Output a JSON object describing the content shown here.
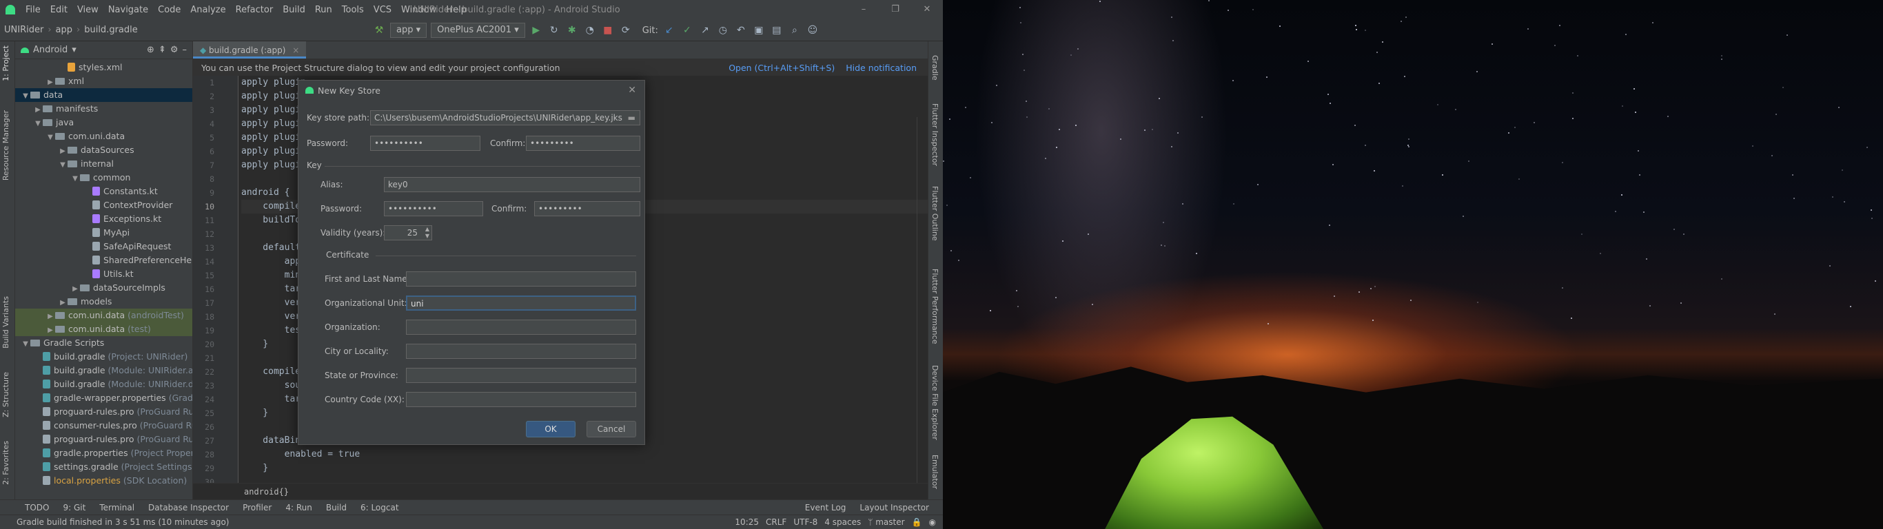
{
  "menubar": {
    "items": [
      "File",
      "Edit",
      "View",
      "Navigate",
      "Code",
      "Analyze",
      "Refactor",
      "Build",
      "Run",
      "Tools",
      "VCS",
      "Window",
      "Help"
    ],
    "window_title": "UNIRider - build.gradle (:app) - Android Studio"
  },
  "navbar": {
    "crumbs": [
      "UNIRider",
      "app",
      "build.gradle"
    ],
    "config": "app",
    "device": "OnePlus AC2001",
    "git_label": "Git:"
  },
  "left_strip": {
    "project": "1: Project",
    "resource": "Resource Manager",
    "build_variants": "Build Variants",
    "structure": "Z: Structure",
    "favorites": "2: Favorites"
  },
  "right_strip": {
    "gradle": "Gradle",
    "flutter_inspector": "Flutter Inspector",
    "flutter_outline": "Flutter Outline",
    "flutter_performance": "Flutter Performance",
    "device_file_explorer": "Device File Explorer",
    "emulator": "Emulator"
  },
  "project": {
    "view": "Android",
    "tree": [
      {
        "label": "styles.xml",
        "indent": 4,
        "kind": "file"
      },
      {
        "label": "xml",
        "indent": 3,
        "kind": "folder",
        "arrow": "▶"
      },
      {
        "label": "data",
        "indent": 1,
        "kind": "folder",
        "arrow": "▼",
        "selected": true
      },
      {
        "label": "manifests",
        "indent": 2,
        "kind": "folder",
        "arrow": "▶"
      },
      {
        "label": "java",
        "indent": 2,
        "kind": "folder",
        "arrow": "▼"
      },
      {
        "label": "com.uni.data",
        "indent": 3,
        "kind": "folder",
        "arrow": "▼"
      },
      {
        "label": "dataSources",
        "indent": 4,
        "kind": "folder",
        "arrow": "▶"
      },
      {
        "label": "internal",
        "indent": 4,
        "kind": "folder",
        "arrow": "▼"
      },
      {
        "label": "common",
        "indent": 5,
        "kind": "folder",
        "arrow": "▼"
      },
      {
        "label": "Constants.kt",
        "indent": 6,
        "kind": "file"
      },
      {
        "label": "ContextProvider",
        "indent": 6,
        "kind": "file"
      },
      {
        "label": "Exceptions.kt",
        "indent": 6,
        "kind": "file"
      },
      {
        "label": "MyApi",
        "indent": 6,
        "kind": "file"
      },
      {
        "label": "SafeApiRequest",
        "indent": 6,
        "kind": "file"
      },
      {
        "label": "SharedPreferenceHelper",
        "indent": 6,
        "kind": "file"
      },
      {
        "label": "Utils.kt",
        "indent": 6,
        "kind": "file"
      },
      {
        "label": "dataSourceImpls",
        "indent": 5,
        "kind": "folder",
        "arrow": "▶"
      },
      {
        "label": "models",
        "indent": 4,
        "kind": "folder",
        "arrow": "▶"
      },
      {
        "label": "com.uni.data",
        "suffix": "(androidTest)",
        "indent": 3,
        "kind": "folder",
        "arrow": "▶",
        "hl": true
      },
      {
        "label": "com.uni.data",
        "suffix": "(test)",
        "indent": 3,
        "kind": "folder",
        "arrow": "▶",
        "hl": true
      },
      {
        "label": "Gradle Scripts",
        "indent": 1,
        "kind": "folder",
        "arrow": "▼"
      },
      {
        "label": "build.gradle",
        "suffix": "(Project: UNIRider)",
        "indent": 2,
        "kind": "file"
      },
      {
        "label": "build.gradle",
        "suffix": "(Module: UNIRider.app)",
        "indent": 2,
        "kind": "file"
      },
      {
        "label": "build.gradle",
        "suffix": "(Module: UNIRider.data)",
        "indent": 2,
        "kind": "file"
      },
      {
        "label": "gradle-wrapper.properties",
        "suffix": "(Gradle Ver",
        "indent": 2,
        "kind": "file"
      },
      {
        "label": "proguard-rules.pro",
        "suffix": "(ProGuard Rules fo",
        "indent": 2,
        "kind": "file"
      },
      {
        "label": "consumer-rules.pro",
        "suffix": "(ProGuard Rules fo",
        "indent": 2,
        "kind": "file"
      },
      {
        "label": "proguard-rules.pro",
        "suffix": "(ProGuard Rules fo",
        "indent": 2,
        "kind": "file"
      },
      {
        "label": "gradle.properties",
        "suffix": "(Project Properties)",
        "indent": 2,
        "kind": "file"
      },
      {
        "label": "settings.gradle",
        "suffix": "(Project Settings)",
        "indent": 2,
        "kind": "file"
      },
      {
        "label": "local.properties",
        "suffix": "(SDK Location)",
        "indent": 2,
        "kind": "file",
        "warn": true
      }
    ]
  },
  "editor": {
    "tab": "build.gradle (:app)",
    "notification": "You can use the Project Structure dialog to view and edit your project configuration",
    "open_link": "Open (Ctrl+Alt+Shift+S)",
    "hide_link": "Hide notification",
    "breadcrumb": "android{}",
    "lines": [
      {
        "n": "1",
        "t": "apply plugin"
      },
      {
        "n": "2",
        "t": "apply plugin"
      },
      {
        "n": "3",
        "t": "apply plugin"
      },
      {
        "n": "4",
        "t": "apply plugin"
      },
      {
        "n": "5",
        "t": "apply plugin"
      },
      {
        "n": "6",
        "t": "apply plugin"
      },
      {
        "n": "7",
        "t": "apply plugin"
      },
      {
        "n": "8",
        "t": ""
      },
      {
        "n": "9",
        "t": "android {"
      },
      {
        "n": "10",
        "t": "    compileS",
        "cur": true
      },
      {
        "n": "11",
        "t": "    buildToo"
      },
      {
        "n": "12",
        "t": ""
      },
      {
        "n": "13",
        "t": "    defaultC"
      },
      {
        "n": "14",
        "t": "        appl"
      },
      {
        "n": "15",
        "t": "        minS"
      },
      {
        "n": "16",
        "t": "        targ"
      },
      {
        "n": "17",
        "t": "        vers"
      },
      {
        "n": "18",
        "t": "        vers"
      },
      {
        "n": "19",
        "t": "        test"
      },
      {
        "n": "20",
        "t": "    }"
      },
      {
        "n": "21",
        "t": ""
      },
      {
        "n": "22",
        "t": "    compileO"
      },
      {
        "n": "23",
        "t": "        sour"
      },
      {
        "n": "24",
        "t": "        targ"
      },
      {
        "n": "25",
        "t": "    }"
      },
      {
        "n": "26",
        "t": ""
      },
      {
        "n": "27",
        "t": "    dataBind"
      },
      {
        "n": "28",
        "t": "        enabled = true"
      },
      {
        "n": "29",
        "t": "    }"
      },
      {
        "n": "30",
        "t": ""
      }
    ]
  },
  "dialog": {
    "title": "New Key Store",
    "keystore_label": "Key store path:",
    "keystore_value": "C:\\Users\\busem\\AndroidStudioProjects\\UNIRider\\app_key.jks",
    "password_label": "Password:",
    "password_value": "••••••••••",
    "confirm_label": "Confirm:",
    "confirm_value": "•••••••••",
    "key_section": "Key",
    "alias_label": "Alias:",
    "alias_value": "key0",
    "key_password_label": "Password:",
    "key_password_value": "••••••••••",
    "key_confirm_label": "Confirm:",
    "key_confirm_value": "•••••••••",
    "validity_label": "Validity (years):",
    "validity_value": "25",
    "cert_section": "Certificate",
    "first_last_label": "First and Last Name:",
    "first_last_value": "",
    "org_unit_label": "Organizational Unit:",
    "org_unit_value": "uni",
    "org_label": "Organization:",
    "org_value": "",
    "city_label": "City or Locality:",
    "city_value": "",
    "state_label": "State or Province:",
    "state_value": "",
    "country_label": "Country Code (XX):",
    "country_value": "",
    "ok": "OK",
    "cancel": "Cancel"
  },
  "toolwindows": [
    "TODO",
    "9: Git",
    "Terminal",
    "Database Inspector",
    "Profiler",
    "4: Run",
    "Build",
    "6: Logcat"
  ],
  "toolwindows_right": [
    "Event Log",
    "Layout Inspector"
  ],
  "status": {
    "message": "Gradle build finished in 3 s 51 ms (10 minutes ago)",
    "position": "10:25",
    "line_sep": "CRLF",
    "encoding": "UTF-8",
    "indent": "4 spaces",
    "branch": "master"
  },
  "colors": {
    "accent": "#4a88c7",
    "bg": "#2b2b2b",
    "panel": "#3c3f41",
    "keyword": "#cc7832"
  }
}
